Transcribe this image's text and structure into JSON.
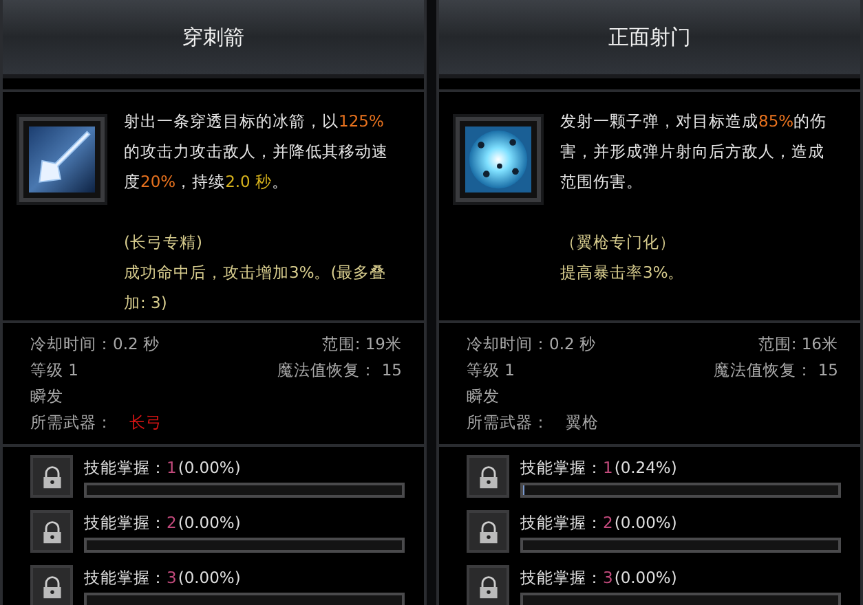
{
  "panels": [
    {
      "title": "穿刺箭",
      "description": [
        {
          "text": "射出一条穿透目标的冰箭，以",
          "kind": "plain"
        },
        {
          "text": "125%",
          "kind": "orange"
        },
        {
          "text": "的攻击力攻击敌人，并降低其移动速度",
          "kind": "plain"
        },
        {
          "text": "20%",
          "kind": "orange"
        },
        {
          "text": "，持续",
          "kind": "plain"
        },
        {
          "text": "2.0 秒",
          "kind": "yellow"
        },
        {
          "text": "。",
          "kind": "plain"
        }
      ],
      "specialization": {
        "title": "(长弓专精)",
        "effect": "成功命中后，攻击增加3%。(最多叠加: 3)"
      },
      "cooldown": "冷却时间：0.2 秒",
      "range": "范围: 19米",
      "level": "等级 1",
      "mana_regen": "魔法值恢复：  15",
      "cast": "瞬发",
      "weapon_label": "所需武器：",
      "weapon": "长弓",
      "weapon_met": false,
      "mastery": [
        {
          "label": "技能掌握：",
          "rank": "1",
          "percent": "(0.00%)",
          "level": 0
        },
        {
          "label": "技能掌握：",
          "rank": "2",
          "percent": "(0.00%)",
          "level": 0
        },
        {
          "label": "技能掌握：",
          "rank": "3",
          "percent": "(0.00%)",
          "level": 0
        }
      ]
    },
    {
      "title": "正面射门",
      "description": [
        {
          "text": "发射一颗子弹，对目标造成",
          "kind": "plain"
        },
        {
          "text": "85%",
          "kind": "orange"
        },
        {
          "text": "的伤害，并形成弹片射向后方敌人，造成范围伤害。",
          "kind": "plain"
        }
      ],
      "specialization": {
        "title": "（翼枪专门化）",
        "effect": "提高暴击率3%。"
      },
      "cooldown": "冷却时间：0.2 秒",
      "range": "范围: 16米",
      "level": "等级 1",
      "mana_regen": "魔法值恢复：  15",
      "cast": "瞬发",
      "weapon_label": "所需武器：",
      "weapon": "翼枪",
      "weapon_met": true,
      "mastery": [
        {
          "label": "技能掌握：",
          "rank": "1",
          "percent": "(0.24%)",
          "level": 0.0024
        },
        {
          "label": "技能掌握：",
          "rank": "2",
          "percent": "(0.00%)",
          "level": 0
        },
        {
          "label": "技能掌握：",
          "rank": "3",
          "percent": "(0.00%)",
          "level": 0
        }
      ]
    }
  ]
}
